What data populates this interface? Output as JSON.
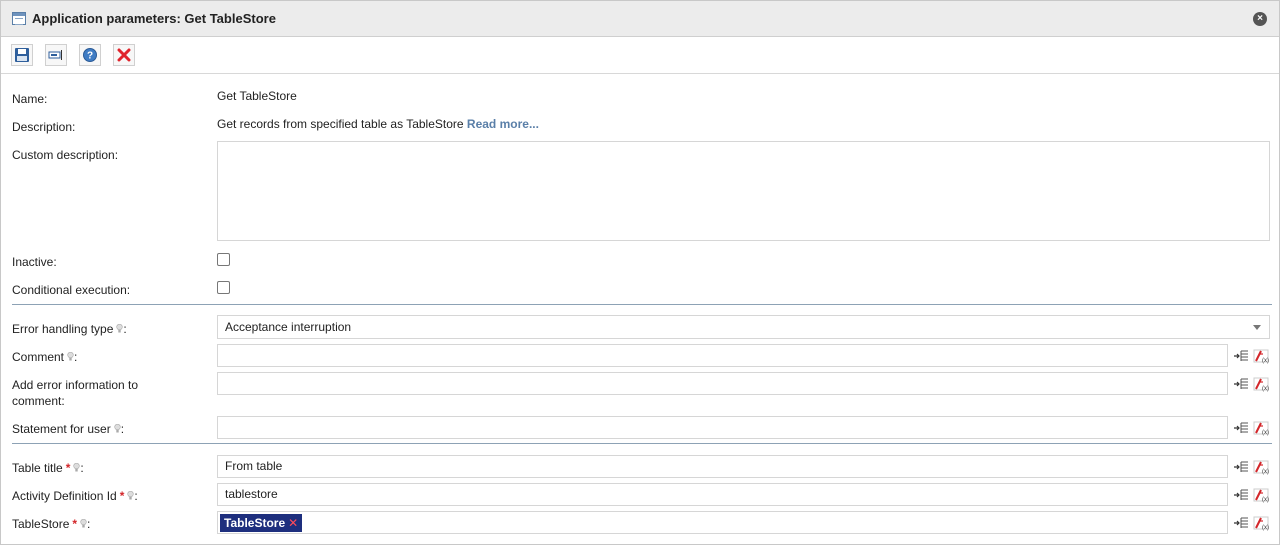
{
  "window": {
    "title": "Application parameters: Get TableStore",
    "close_symbol": "×"
  },
  "toolbar": {
    "buttons": [
      {
        "name": "save",
        "icon": "save-icon"
      },
      {
        "name": "rename",
        "icon": "rename-icon"
      },
      {
        "name": "help",
        "icon": "help-icon"
      },
      {
        "name": "cancel",
        "icon": "cancel-icon"
      }
    ]
  },
  "form": {
    "name": {
      "label": "Name:",
      "value": "Get TableStore"
    },
    "description": {
      "label": "Description:",
      "value": "Get records from specified table as TableStore",
      "link": "Read more..."
    },
    "custom_description": {
      "label": "Custom description:",
      "value": ""
    },
    "inactive": {
      "label": "Inactive:",
      "checked": false
    },
    "conditional_execution": {
      "label": "Conditional execution:",
      "checked": false
    },
    "error_handling_type": {
      "label": "Error handling type",
      "suffix": ":",
      "value": "Acceptance interruption"
    },
    "comment": {
      "label": "Comment",
      "suffix": ":",
      "value": ""
    },
    "add_error_info": {
      "label_line1": "Add error information to",
      "label_line2": "comment:",
      "value": ""
    },
    "statement_for_user": {
      "label": "Statement for user",
      "suffix": ":",
      "value": ""
    },
    "table_title": {
      "label": "Table title",
      "required": "*",
      "suffix": ":",
      "value": "From table"
    },
    "activity_definition_id": {
      "label": "Activity Definition Id",
      "required": "*",
      "suffix": ":",
      "value": "tablestore"
    },
    "tablestore": {
      "label": "TableStore",
      "required": "*",
      "suffix": ":",
      "tag": "TableStore",
      "tag_remove": "✕"
    }
  },
  "colors": {
    "accent": "#1e2f7e",
    "link": "#5a7fa8",
    "required": "#d3262a",
    "separator": "#8da2b5"
  }
}
